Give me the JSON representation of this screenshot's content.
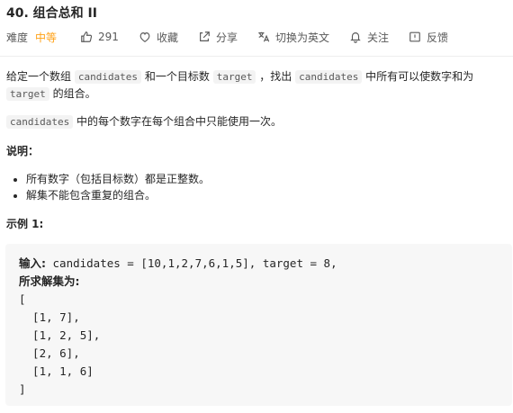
{
  "problem": {
    "title": "40. 组合总和 II",
    "difficulty_label": "难度",
    "difficulty": "中等",
    "likes": "291",
    "favorite_label": "收藏",
    "share_label": "分享",
    "switch_lang_label": "切换为英文",
    "follow_label": "关注",
    "feedback_label": "反馈"
  },
  "description": {
    "p1_part1": "给定一个数组 ",
    "p1_code1": "candidates",
    "p1_part2": " 和一个目标数 ",
    "p1_code2": "target",
    "p1_part3": " ，找出 ",
    "p1_code3": "candidates",
    "p1_part4": " 中所有可以使数字和为 ",
    "p1_code4": "target",
    "p1_part5": " 的组合。",
    "p2_code": "candidates",
    "p2_text": " 中的每个数字在每个组合中只能使用一次。",
    "note_heading": "说明：",
    "bullets": [
      "所有数字（包括目标数）都是正整数。",
      "解集不能包含重复的组合。"
    ],
    "example_heading": "示例 1:"
  },
  "example": {
    "input_label": "输入:",
    "input_text": " candidates = [10,1,2,7,6,1,5], target = 8,",
    "output_label": "所求解集为:",
    "lines": [
      "[",
      "  [1, 7],",
      "  [1, 2, 5],",
      "  [2, 6],",
      "  [1, 1, 6]",
      "]"
    ]
  },
  "colors": {
    "accent": "#ffa116",
    "code_bg": "#f3f3f3",
    "box_bg": "#f7f7f7"
  },
  "icons": [
    "thumbs-up-icon",
    "heart-icon",
    "share-icon",
    "translate-icon",
    "bell-icon",
    "feedback-icon"
  ]
}
